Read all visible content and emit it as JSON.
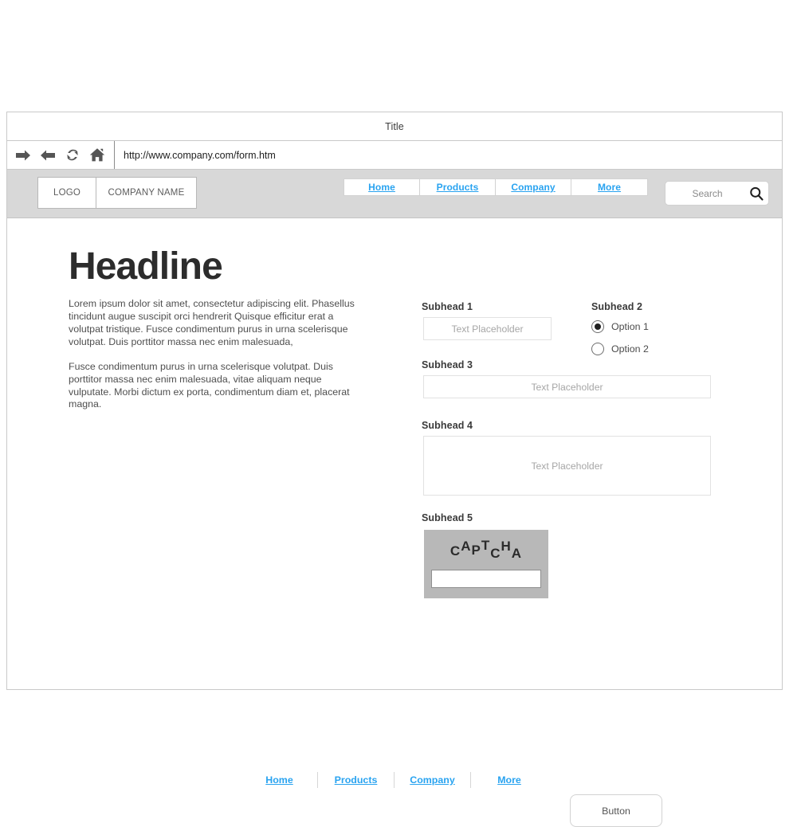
{
  "browser": {
    "title": "Title",
    "url": "http://www.company.com/form.htm",
    "nav_icons": [
      {
        "name": "back-arrow-icon",
        "label": "Back"
      },
      {
        "name": "forward-arrow-icon",
        "label": "Forward"
      },
      {
        "name": "refresh-icon",
        "label": "Refresh"
      },
      {
        "name": "home-icon",
        "label": "Home"
      }
    ]
  },
  "site_header": {
    "logo_label": "LOGO",
    "company_name": "COMPANY NAME",
    "nav_items": [
      {
        "label": "Home"
      },
      {
        "label": "Products"
      },
      {
        "label": "Company"
      },
      {
        "label": "More"
      }
    ],
    "search": {
      "placeholder": "Search",
      "icon": "magnifier-icon"
    }
  },
  "main": {
    "headline": "Headline",
    "paragraph_1": "Lorem ipsum dolor sit amet, consectetur adipiscing elit. Phasellus tincidunt augue suscipit orci hendrerit Quisque efficitur erat a volutpat tristique. Fusce condimentum purus in urna scelerisque volutpat. Duis porttitor massa nec enim malesuada,",
    "paragraph_2": "Fusce condimentum purus in urna scelerisque volutpat. Duis porttitor massa nec enim malesuada, vitae aliquam neque vulputate. Morbi dictum ex porta, condimentum diam et, placerat magna."
  },
  "form": {
    "subhead_1": "Subhead 1",
    "field_1_placeholder": "Text Placeholder",
    "subhead_2": "Subhead 2",
    "options": [
      {
        "label": "Option 1",
        "selected": true
      },
      {
        "label": "Option 2",
        "selected": false
      }
    ],
    "subhead_3": "Subhead 3",
    "field_3_placeholder": "Text Placeholder",
    "subhead_4": "Subhead 4",
    "field_4_placeholder": "Text Placeholder",
    "subhead_5": "Subhead 5",
    "captcha": {
      "letters": [
        "C",
        "A",
        "P",
        "T",
        "C",
        "H",
        "A"
      ],
      "input_value": ""
    },
    "button_label": "Button"
  },
  "footer": {
    "links": [
      {
        "label": "Home"
      },
      {
        "label": "Products"
      },
      {
        "label": "Company"
      },
      {
        "label": "More"
      }
    ]
  },
  "colors": {
    "link_blue": "#29a3f0",
    "header_gray": "#d8d8d8",
    "captcha_gray": "#b8b8b8",
    "text_dark": "#3a3a3a"
  }
}
